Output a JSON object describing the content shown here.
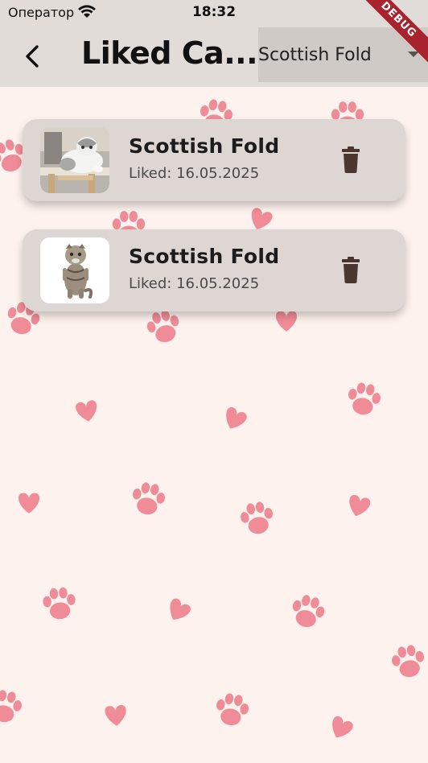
{
  "status_bar": {
    "carrier": "Оператор",
    "time": "18:32",
    "wifi_icon": "wifi-icon"
  },
  "app_bar": {
    "title": "Liked Ca...",
    "back_icon": "chevron-left-icon",
    "breed_filter": {
      "selected": "Scottish Fold",
      "arrow_icon": "dropdown-arrow-icon"
    }
  },
  "debug_banner": "DEBUG",
  "liked_cats": [
    {
      "breed": "Scottish Fold",
      "liked": "Liked: 16.05.2025",
      "photo": "grey-white-cat-on-cat-tree",
      "delete_icon": "trash-icon"
    },
    {
      "breed": "Scottish Fold",
      "liked": "Liked: 16.05.2025",
      "photo": "tabby-kitten-standing-white-background",
      "delete_icon": "trash-icon"
    }
  ],
  "background_pattern": {
    "motifs": [
      "paw-icon",
      "heart-icon"
    ],
    "color": "#f08c98"
  },
  "colors": {
    "background": "#fdf2ee",
    "app_bar": "#e2dcd8",
    "card": "#ddd6d3",
    "delete_icon": "#4a3530",
    "debug_ribbon": "#a8232d"
  }
}
